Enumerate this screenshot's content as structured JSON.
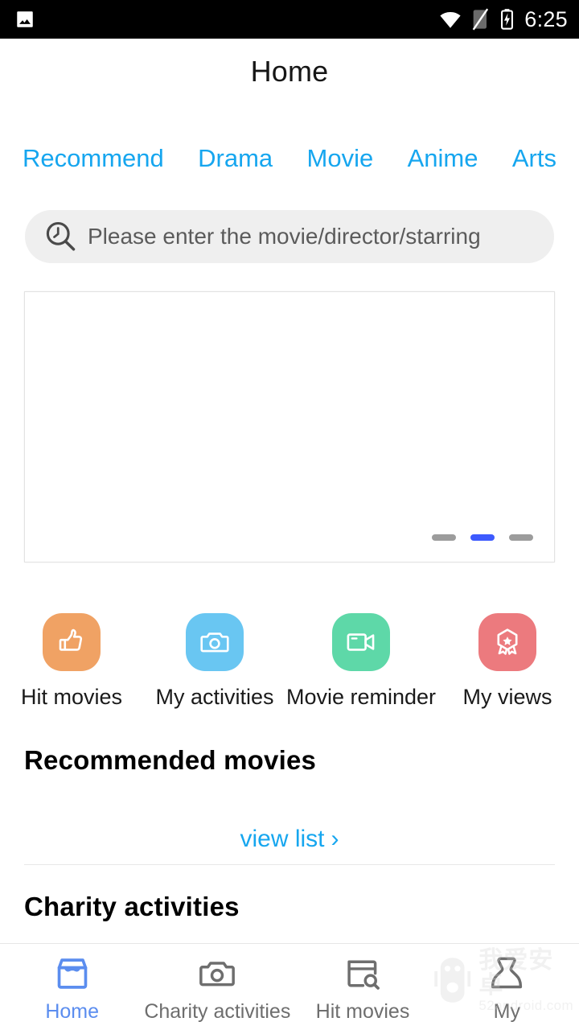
{
  "status_bar": {
    "time": "6:25",
    "icons": [
      "gallery-image-icon",
      "wifi-icon",
      "signal-off-icon",
      "battery-charging-icon"
    ]
  },
  "header": {
    "title": "Home"
  },
  "tabs": [
    {
      "label": "Recommend",
      "active": true
    },
    {
      "label": "Drama",
      "active": false
    },
    {
      "label": "Movie",
      "active": false
    },
    {
      "label": "Anime",
      "active": false
    },
    {
      "label": "Arts",
      "active": false
    }
  ],
  "search": {
    "placeholder": "Please enter the movie/director/starring",
    "value": "",
    "icon": "search-history-icon"
  },
  "banner": {
    "dots": [
      {
        "active": false
      },
      {
        "active": true
      },
      {
        "active": false
      }
    ]
  },
  "quick_actions": [
    {
      "label": "Hit movies",
      "icon": "thumbs-up-icon",
      "color": "#F0A264"
    },
    {
      "label": "My activities",
      "icon": "camera-icon",
      "color": "#69C6F2"
    },
    {
      "label": "Movie reminder",
      "icon": "video-camera-icon",
      "color": "#5ED8A8"
    },
    {
      "label": "My views",
      "icon": "medal-badge-icon",
      "color": "#EC7A7E"
    }
  ],
  "sections": {
    "recommended": {
      "heading": "Recommended movies",
      "view_list_label": "view list",
      "chevron": "›"
    },
    "charity": {
      "heading": "Charity activities"
    }
  },
  "bottom_nav": [
    {
      "label": "Home",
      "icon": "store-box-icon",
      "active": true
    },
    {
      "label": "Charity activities",
      "icon": "camera-icon",
      "active": false
    },
    {
      "label": "Hit movies",
      "icon": "window-search-icon",
      "active": false
    },
    {
      "label": "My",
      "icon": "person-icon",
      "active": false
    }
  ],
  "watermark": {
    "cn": "我爱安卓",
    "en": "52android.com",
    "icon": "android-robot-icon"
  },
  "colors": {
    "accent_blue": "#16A6EF",
    "nav_active_blue": "#5B8DEF",
    "dot_active": "#3D5AFE",
    "search_bg": "#EFEFEF"
  }
}
